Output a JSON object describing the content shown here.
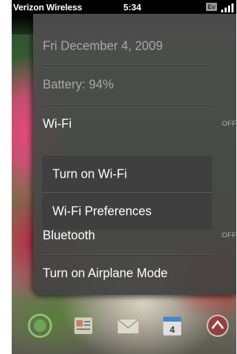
{
  "status_bar": {
    "carrier": "Verizon Wireless",
    "time": "5:34",
    "network_badge": "Ev",
    "signal_icon": "signal-bars-icon"
  },
  "menu": {
    "date": "Fri December 4, 2009",
    "battery": "Battery: 94%",
    "wifi": {
      "label": "Wi-Fi",
      "state": "OFF"
    },
    "wifi_submenu": {
      "turn_on": "Turn on Wi-Fi",
      "preferences": "Wi-Fi Preferences"
    },
    "bluetooth": {
      "label": "Bluetooth",
      "state": "OFF"
    },
    "airplane_mode": "Turn on Airplane Mode"
  },
  "dock": {
    "icons": [
      "phone-icon",
      "contacts-icon",
      "email-icon",
      "calendar-icon",
      "launcher-icon"
    ],
    "calendar_day": "4"
  }
}
